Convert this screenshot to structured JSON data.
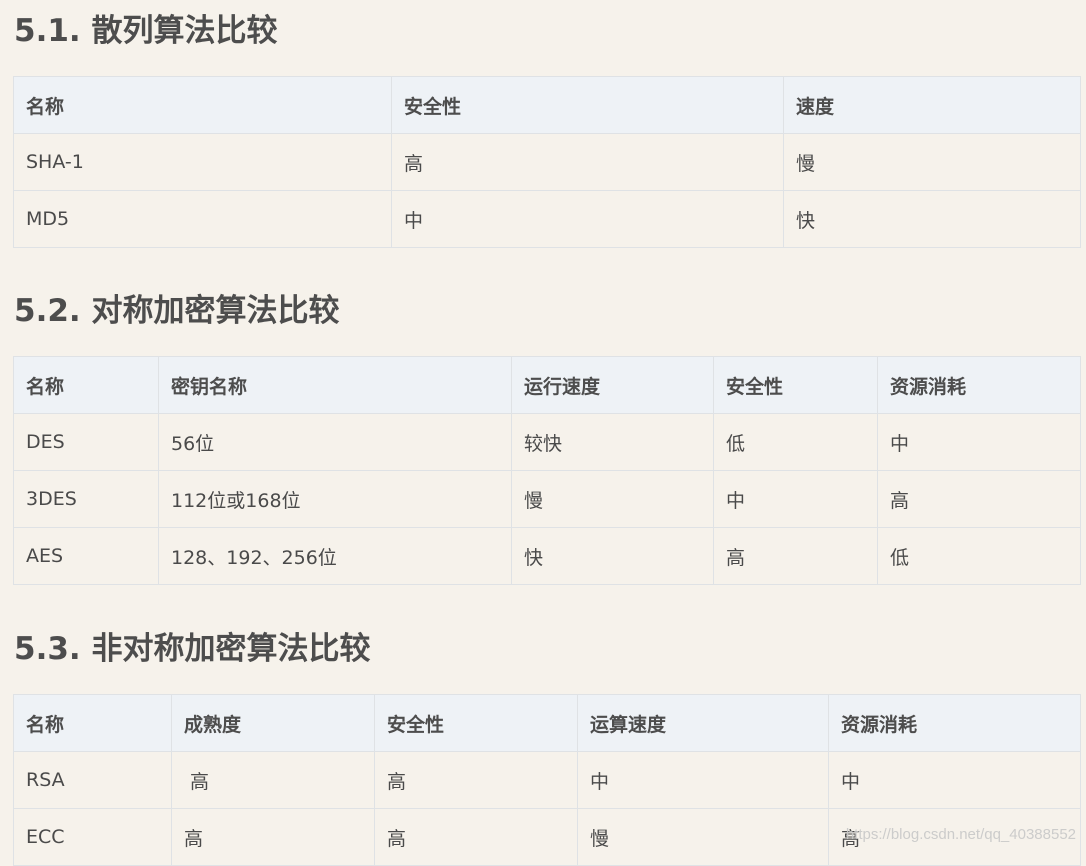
{
  "sections": [
    {
      "title": "5.1. 散列算法比较",
      "headers": [
        "名称",
        "安全性",
        "速度"
      ],
      "rows": [
        [
          "SHA-1",
          "高",
          "慢"
        ],
        [
          "MD5",
          "中",
          "快"
        ]
      ]
    },
    {
      "title": "5.2. 对称加密算法比较",
      "headers": [
        "名称",
        "密钥名称",
        "运行速度",
        "安全性",
        "资源消耗"
      ],
      "rows": [
        [
          "DES",
          "56位",
          "较快",
          "低",
          "中"
        ],
        [
          "3DES",
          "112位或168位",
          "慢",
          "中",
          "高"
        ],
        [
          "AES",
          "128、192、256位",
          "快",
          "高",
          "低"
        ]
      ]
    },
    {
      "title": "5.3. 非对称加密算法比较",
      "headers": [
        "名称",
        "成熟度",
        "安全性",
        "运算速度",
        "资源消耗"
      ],
      "rows": [
        [
          "RSA",
          " 高",
          "高",
          "中",
          "中"
        ],
        [
          "ECC",
          "高",
          "高",
          "慢",
          "高"
        ]
      ]
    }
  ],
  "watermark": "https://blog.csdn.net/qq_40388552"
}
